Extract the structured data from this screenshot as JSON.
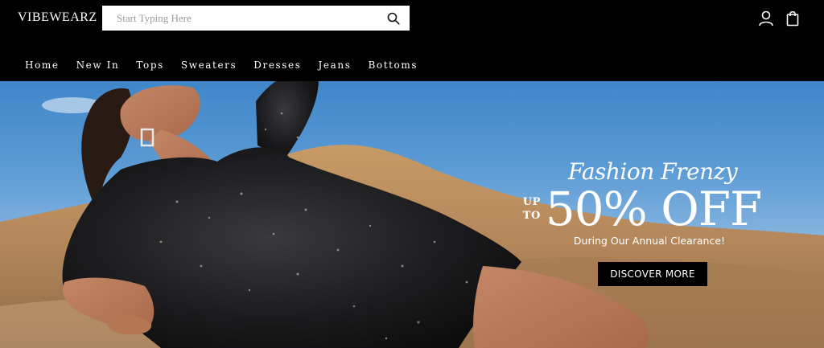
{
  "header": {
    "logo": "VIBEWEARZ",
    "search": {
      "placeholder": "Start Typing Here",
      "value": ""
    },
    "icons": {
      "search": "search-icon",
      "account": "user-icon",
      "cart": "shopping-bag-icon"
    }
  },
  "nav": {
    "items": [
      {
        "label": "Home"
      },
      {
        "label": "New In"
      },
      {
        "label": "Tops"
      },
      {
        "label": "Sweaters"
      },
      {
        "label": "Dresses"
      },
      {
        "label": "Jeans"
      },
      {
        "label": "Bottoms"
      }
    ]
  },
  "hero": {
    "tagline": "Fashion Frenzy",
    "upto_line1": "UP",
    "upto_line2": "TO",
    "headline": "50% OFF",
    "subtext": "During Our Annual Clearance!",
    "cta_label": "DISCOVER MORE"
  },
  "colors": {
    "header_bg": "#000000",
    "button_bg": "#000000",
    "sky": "#5e9dd6",
    "sand": "#b88a58"
  }
}
